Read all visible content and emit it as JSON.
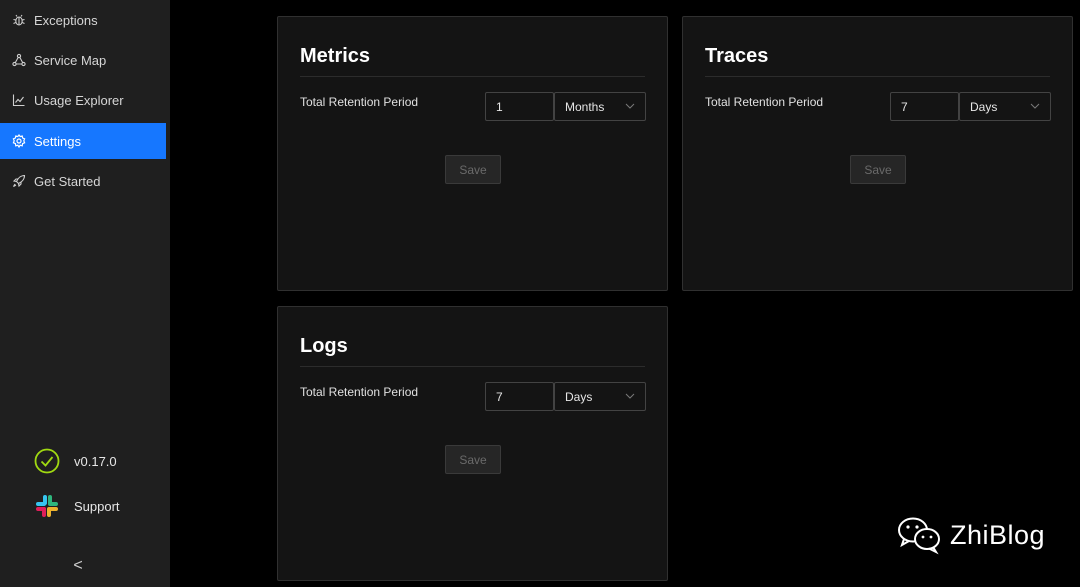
{
  "sidebar": {
    "items": [
      {
        "label": "Exceptions",
        "icon": "bug-icon"
      },
      {
        "label": "Service Map",
        "icon": "service-map-icon"
      },
      {
        "label": "Usage Explorer",
        "icon": "line-chart-icon"
      },
      {
        "label": "Settings",
        "icon": "gear-icon",
        "active": true
      },
      {
        "label": "Get Started",
        "icon": "rocket-icon"
      }
    ],
    "version": "v0.17.0",
    "support_label": "Support",
    "collapse_glyph": "<"
  },
  "cards": {
    "metrics": {
      "title": "Metrics",
      "field_label": "Total Retention Period",
      "value": "1",
      "unit": "Months",
      "save_label": "Save"
    },
    "traces": {
      "title": "Traces",
      "field_label": "Total Retention Period",
      "value": "7",
      "unit": "Days",
      "save_label": "Save"
    },
    "logs": {
      "title": "Logs",
      "field_label": "Total Retention Period",
      "value": "7",
      "unit": "Days",
      "save_label": "Save"
    }
  },
  "watermark": {
    "text": "ZhiBlog",
    "icon": "wechat-icon"
  },
  "colors": {
    "accent": "#1677ff",
    "sidebar_bg": "#1f1f1f",
    "card_bg": "#141414",
    "success": "#a0d911"
  }
}
